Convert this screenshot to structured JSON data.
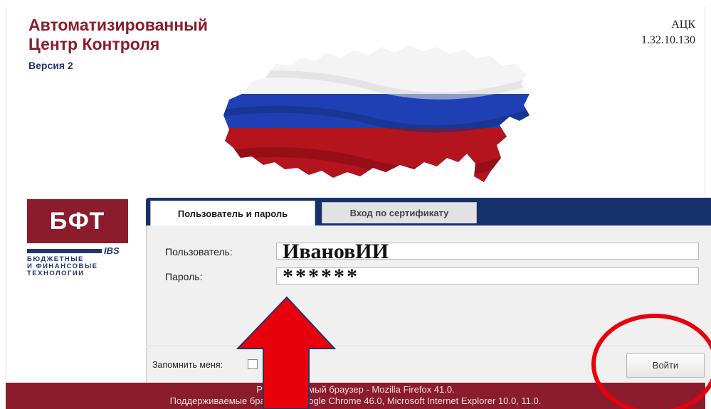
{
  "header": {
    "title": "Автоматизированный\nЦентр Контроля",
    "version": "Версия 2",
    "app_code": "АЦК",
    "app_build": "1.32.10.130"
  },
  "logo": {
    "letters": "БФТ",
    "ibs": "IBS",
    "subtitle": "БЮДЖЕТНЫЕ\nИ ФИНАНСОВЫЕ\nТЕХНОЛОГИИ"
  },
  "tabs": [
    {
      "label": "Пользователь и пароль",
      "active": true
    },
    {
      "label": "Вход по сертификату",
      "active": false
    }
  ],
  "form": {
    "user_label": "Пользователь:",
    "user_value": "ИвановИИ",
    "password_label": "Пароль:",
    "password_value": "******",
    "remember_label": "Запомнить меня:",
    "remember_checked": false,
    "login_label": "Войти"
  },
  "footer": {
    "line1": "Рекомендуемый браузер - Mozilla Firefox 41.0.",
    "line2": "Поддерживаемые браузеры: Google Chrome 46.0, Microsoft Internet Explorer 10.0, 11.0."
  },
  "colors": {
    "brand_red": "#8a1c2c",
    "brand_blue": "#16306a",
    "annotation_red": "#e8000c"
  },
  "annotations": {
    "arrow": "red-up-arrow",
    "circle": "red-circle"
  }
}
